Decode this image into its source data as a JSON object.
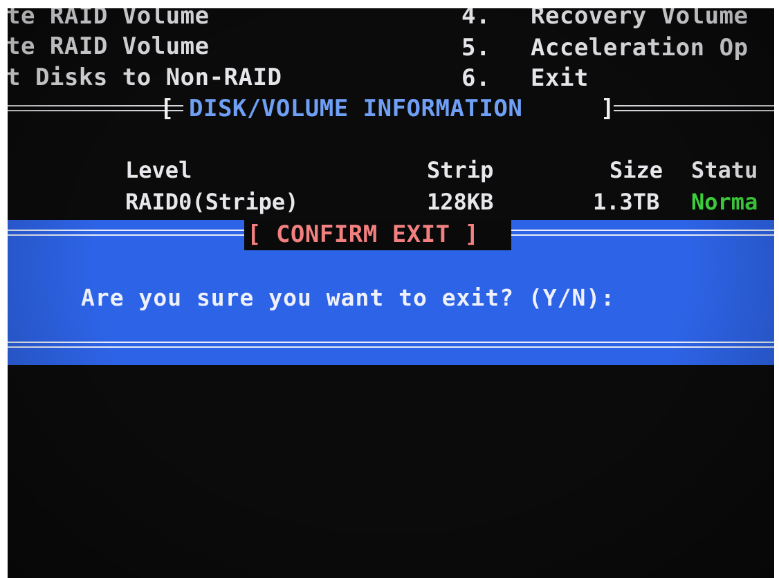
{
  "menu": {
    "items": [
      {
        "label": "te RAID Volume"
      },
      {
        "label": "te RAID Volume"
      },
      {
        "label": "t Disks to Non-RAID"
      },
      {
        "num": "4.",
        "label": "Recovery Volume"
      },
      {
        "num": "5.",
        "label": "Acceleration Op"
      },
      {
        "num": "6.",
        "label": "Exit"
      }
    ]
  },
  "disk_section": {
    "title": "DISK/VOLUME INFORMATION",
    "bracket_open": "[",
    "bracket_close": "]",
    "headers": {
      "level": "Level",
      "strip": "Strip",
      "size": "Size",
      "status": "Statu"
    },
    "row": {
      "level": "RAID0(Stripe)",
      "strip": "128KB",
      "size": "1.3TB",
      "status": "Norma"
    }
  },
  "dialog": {
    "title": "[ CONFIRM EXIT ]",
    "prompt": "Are you sure you want to exit? (Y/N):"
  },
  "colors": {
    "background": "#0b0b0b",
    "dialog_blue": "#2d63e6",
    "section_title": "#6fa0f5",
    "dialog_title": "#f28080",
    "status_normal": "#3ed43e"
  }
}
